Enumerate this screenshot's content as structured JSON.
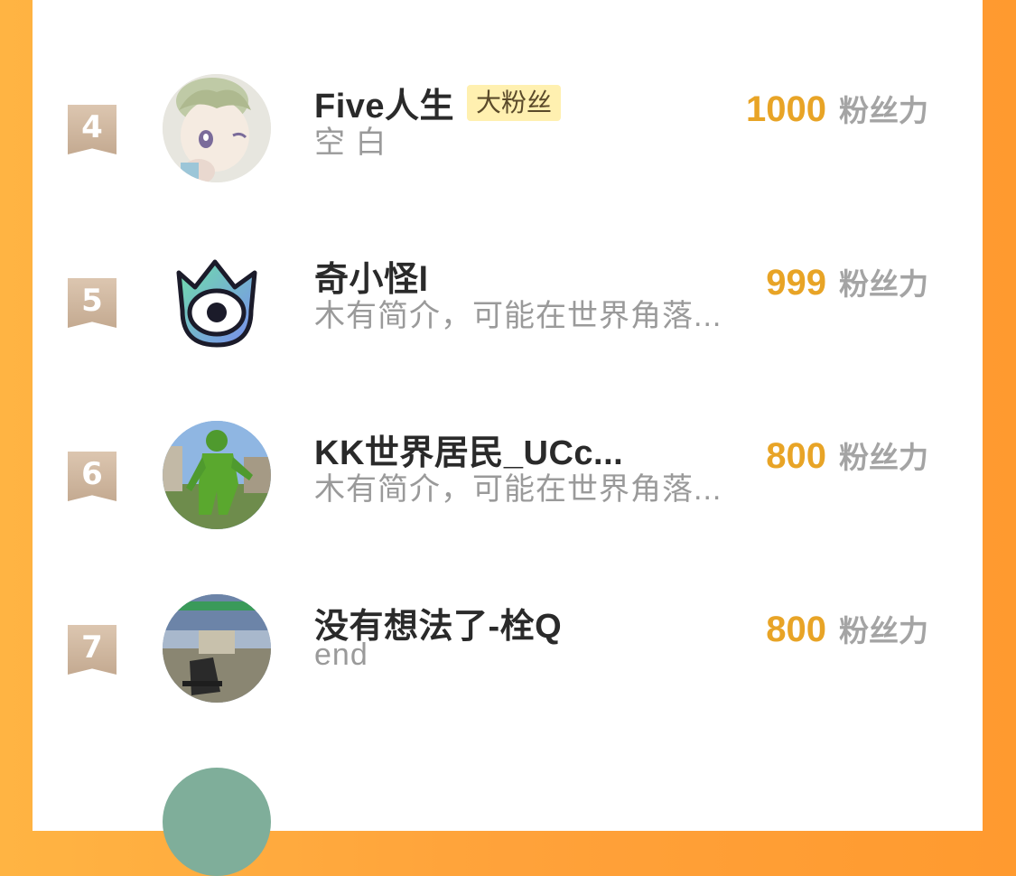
{
  "rows": [
    {
      "rank": "4",
      "name": "Five人生",
      "badge": "大粉丝",
      "bio": "空 白",
      "score": "1000",
      "unit": "粉丝力",
      "avatar_icon": "anime-child-avatar"
    },
    {
      "rank": "5",
      "name": "奇小怪l",
      "badge": "",
      "bio": "木有简介，可能在世界角落...",
      "score": "999",
      "unit": "粉丝力",
      "avatar_icon": "one-eyed-monster-avatar"
    },
    {
      "rank": "6",
      "name": "KK世界居民_UCc...",
      "badge": "",
      "bio": "木有简介，可能在世界角落...",
      "score": "800",
      "unit": "粉丝力",
      "avatar_icon": "green-robot-game-avatar"
    },
    {
      "rank": "7",
      "name": "没有想法了-栓Q",
      "badge": "",
      "bio": "end",
      "score": "800",
      "unit": "粉丝力",
      "avatar_icon": "shooter-game-avatar"
    }
  ],
  "colors": {
    "background_orange": "#ffa23a",
    "score_gold": "#e8a426",
    "badge_bg": "#fff0b0",
    "rank_flag": "#c9b098"
  }
}
